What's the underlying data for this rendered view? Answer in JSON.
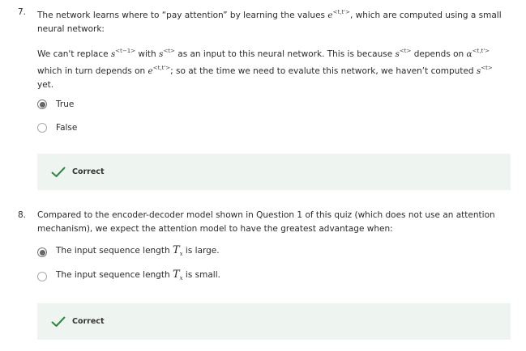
{
  "q7": {
    "number": "7.",
    "stem_a": "The network learns where to “pay attention” by learning the values ",
    "stem_e": "e",
    "stem_e_sup": "<t,t'>",
    "stem_b": ", which are computed using a small neural network:",
    "line2_a": "We can't replace ",
    "line2_s1": "s",
    "line2_s1_sup": "<t−1>",
    "line2_b": " with ",
    "line2_s2": "s",
    "line2_s2_sup": "<t>",
    "line2_c": " as an input to this neural network. This is because ",
    "line2_s3": "s",
    "line2_s3_sup": "<t>",
    "line2_d": " depends on ",
    "line2_alpha": "α",
    "line2_alpha_sup": "<t,t'>",
    "line3_a": "which in turn depends on ",
    "line3_e": "e",
    "line3_e_sup": "<t,t'>",
    "line3_b": "; so at the time we need to evalute this network, we haven’t computed ",
    "line3_s": "s",
    "line3_s_sup": "<t>",
    "line4": "yet.",
    "options": [
      {
        "label": "True",
        "checked": true
      },
      {
        "label": "False",
        "checked": false
      }
    ],
    "feedback": "Correct"
  },
  "q8": {
    "number": "8.",
    "stem": "Compared to the encoder-decoder model shown in Question 1 of this quiz (which does not use an attention mechanism), we expect the attention model to have the greatest advantage when:",
    "options": [
      {
        "label_a": "The input sequence length ",
        "T": "T",
        "sub": "x",
        "label_b": " is large.",
        "checked": true
      },
      {
        "label_a": "The input sequence length ",
        "T": "T",
        "sub": "x",
        "label_b": " is small.",
        "checked": false
      }
    ],
    "feedback": "Correct"
  },
  "colors": {
    "check": "#2e8540",
    "feedback_bg": "#eef5f1"
  }
}
